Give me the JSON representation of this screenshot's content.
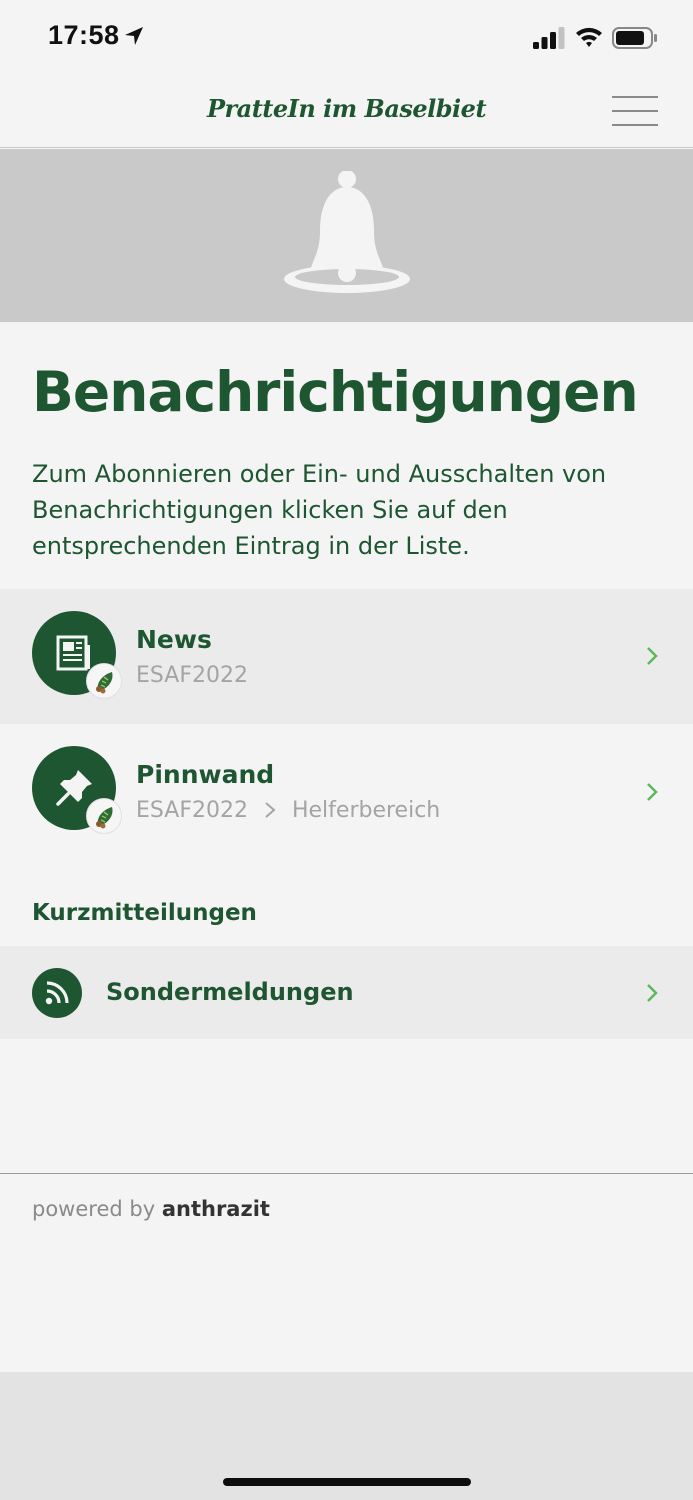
{
  "status_bar": {
    "time": "17:58"
  },
  "header": {
    "brand": "PratteIn im Baselbiet"
  },
  "page": {
    "title": "Benachrichtigungen",
    "intro": "Zum Abonnieren oder Ein- und Ausschalten von Benachrichtigungen klicken Sie auf den entsprechenden Eintrag in der Liste."
  },
  "list": {
    "items": [
      {
        "title": "News",
        "subtitle": "ESAF2022"
      },
      {
        "title": "Pinnwand",
        "subtitle_parts": [
          "ESAF2022",
          "Helferbereich"
        ]
      }
    ]
  },
  "short_messages": {
    "heading": "Kurzmitteilungen",
    "items": [
      {
        "title": "Sondermeldungen"
      }
    ]
  },
  "footer": {
    "powered_prefix": "powered by",
    "powered_brand": "anthrazit"
  },
  "colors": {
    "accent": "#1e5631",
    "chevron": "#5db85c",
    "muted": "#a4a4a4"
  },
  "icons": {
    "news": "newspaper-icon",
    "pinnwand": "pushpin-icon",
    "sonder": "rss-icon",
    "hero": "bell-icon",
    "badge": "oak-leaf-icon"
  }
}
